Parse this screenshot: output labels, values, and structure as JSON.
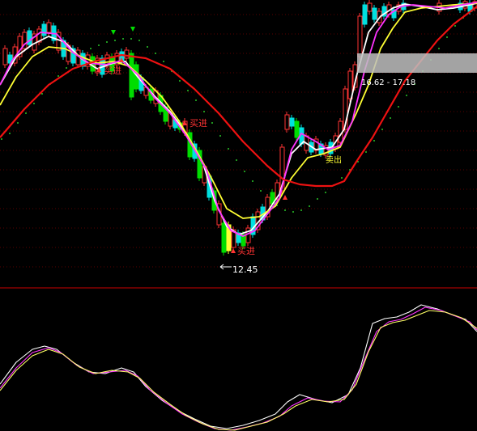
{
  "chart_data": [
    {
      "type": "candlestick",
      "panel": "main",
      "annotations": {
        "low_price_label": "12.45",
        "price_range_label": "16.62 - 17.18",
        "signals": [
          "买进",
          "买进",
          "卖出",
          "买进"
        ]
      },
      "colors": {
        "up": "#ff3333",
        "down": "#00e0e0",
        "green_bar": "#00dd00",
        "ma_white": "#ffffff",
        "ma_yellow": "#ffff33",
        "ma_magenta": "#ff33ff",
        "ma_red": "#ee1111",
        "dots": "#33ff33"
      },
      "series": [
        {
          "values": [
            [
              0,
              105
            ],
            [
              20,
              70
            ],
            [
              40,
              55
            ],
            [
              60,
              45
            ],
            [
              80,
              52
            ],
            [
              100,
              72
            ],
            [
              120,
              85
            ],
            [
              140,
              78
            ],
            [
              155,
              76
            ],
            [
              170,
              95
            ],
            [
              190,
              118
            ],
            [
              210,
              138
            ],
            [
              230,
              165
            ],
            [
              250,
              200
            ],
            [
              265,
              248
            ],
            [
              280,
              280
            ],
            [
              295,
              290
            ],
            [
              310,
              285
            ],
            [
              330,
              262
            ],
            [
              345,
              240
            ],
            [
              360,
              190
            ],
            [
              375,
              175
            ],
            [
              390,
              185
            ],
            [
              410,
              182
            ],
            [
              425,
              160
            ],
            [
              440,
              95
            ],
            [
              455,
              40
            ],
            [
              470,
              20
            ],
            [
              485,
              10
            ],
            [
              500,
              5
            ],
            [
              520,
              8
            ],
            [
              540,
              12
            ],
            [
              560,
              10
            ],
            [
              580,
              6
            ],
            [
              589,
              4
            ]
          ]
        },
        {
          "values": [
            [
              0,
              130
            ],
            [
              20,
              95
            ],
            [
              40,
              70
            ],
            [
              60,
              58
            ],
            [
              80,
              60
            ],
            [
              100,
              70
            ],
            [
              120,
              78
            ],
            [
              140,
              76
            ],
            [
              160,
              82
            ],
            [
              180,
              100
            ],
            [
              200,
              120
            ],
            [
              220,
              148
            ],
            [
              240,
              182
            ],
            [
              260,
              218
            ],
            [
              280,
              258
            ],
            [
              300,
              270
            ],
            [
              320,
              268
            ],
            [
              340,
              255
            ],
            [
              360,
              220
            ],
            [
              380,
              195
            ],
            [
              400,
              190
            ],
            [
              420,
              182
            ],
            [
              440,
              140
            ],
            [
              455,
              105
            ],
            [
              470,
              60
            ],
            [
              485,
              35
            ],
            [
              500,
              15
            ],
            [
              520,
              10
            ],
            [
              540,
              8
            ],
            [
              560,
              6
            ],
            [
              589,
              4
            ]
          ]
        },
        {
          "values": [
            [
              0,
              105
            ],
            [
              15,
              75
            ],
            [
              30,
              55
            ],
            [
              50,
              40
            ],
            [
              70,
              42
            ],
            [
              90,
              65
            ],
            [
              110,
              78
            ],
            [
              130,
              80
            ],
            [
              150,
              75
            ],
            [
              170,
              92
            ],
            [
              190,
              120
            ],
            [
              210,
              140
            ],
            [
              230,
              168
            ],
            [
              255,
              210
            ],
            [
              270,
              260
            ],
            [
              285,
              285
            ],
            [
              300,
              292
            ],
            [
              315,
              285
            ],
            [
              330,
              265
            ],
            [
              345,
              245
            ],
            [
              360,
              185
            ],
            [
              372,
              165
            ],
            [
              390,
              175
            ],
            [
              405,
              185
            ],
            [
              420,
              180
            ],
            [
              435,
              150
            ],
            [
              450,
              88
            ],
            [
              465,
              40
            ],
            [
              480,
              18
            ],
            [
              495,
              8
            ],
            [
              510,
              6
            ],
            [
              530,
              8
            ],
            [
              550,
              10
            ],
            [
              570,
              6
            ],
            [
              589,
              3
            ]
          ]
        },
        {
          "values": [
            [
              0,
              170
            ],
            [
              30,
              135
            ],
            [
              60,
              105
            ],
            [
              90,
              85
            ],
            [
              120,
              75
            ],
            [
              150,
              68
            ],
            [
              180,
              72
            ],
            [
              210,
              85
            ],
            [
              240,
              110
            ],
            [
              270,
              140
            ],
            [
              300,
              175
            ],
            [
              330,
              205
            ],
            [
              350,
              222
            ],
            [
              370,
              228
            ],
            [
              390,
              230
            ],
            [
              410,
              230
            ],
            [
              425,
              224
            ],
            [
              440,
              200
            ],
            [
              460,
              170
            ],
            [
              480,
              135
            ],
            [
              500,
              100
            ],
            [
              520,
              75
            ],
            [
              540,
              50
            ],
            [
              560,
              30
            ],
            [
              589,
              8
            ]
          ]
        },
        {
          "values": [
            [
              0,
              175
            ],
            [
              40,
              140
            ],
            [
              80,
              105
            ],
            [
              120,
              70
            ],
            [
              150,
              52
            ],
            [
              180,
              60
            ],
            [
              210,
              78
            ],
            [
              240,
              108
            ],
            [
              270,
              150
            ],
            [
              300,
              198
            ],
            [
              330,
              238
            ],
            [
              360,
              256
            ],
            [
              390,
              252
            ],
            [
              420,
              238
            ],
            [
              440,
              213
            ],
            [
              460,
              178
            ],
            [
              480,
              138
            ],
            [
              500,
              100
            ],
            [
              520,
              70
            ],
            [
              540,
              45
            ],
            [
              560,
              25
            ],
            [
              589,
              5
            ]
          ]
        }
      ]
    },
    {
      "type": "line",
      "panel": "indicator",
      "series": [
        {
          "values": [
            [
              0,
              475
            ],
            [
              20,
              448
            ],
            [
              40,
              432
            ],
            [
              55,
              428
            ],
            [
              70,
              432
            ],
            [
              90,
              448
            ],
            [
              110,
              460
            ],
            [
              130,
              462
            ],
            [
              150,
              455
            ],
            [
              165,
              460
            ],
            [
              180,
              478
            ],
            [
              200,
              495
            ],
            [
              220,
              508
            ],
            [
              240,
              518
            ],
            [
              260,
              527
            ],
            [
              280,
              530
            ],
            [
              300,
              526
            ],
            [
              320,
              520
            ],
            [
              340,
              512
            ],
            [
              355,
              497
            ],
            [
              370,
              488
            ],
            [
              390,
              494
            ],
            [
              410,
              498
            ],
            [
              430,
              488
            ],
            [
              445,
              455
            ],
            [
              460,
              400
            ],
            [
              475,
              394
            ],
            [
              490,
              392
            ],
            [
              505,
              386
            ],
            [
              520,
              377
            ],
            [
              540,
              382
            ],
            [
              560,
              390
            ],
            [
              575,
              395
            ],
            [
              589,
              410
            ]
          ]
        },
        {
          "values": [
            [
              0,
              480
            ],
            [
              20,
              455
            ],
            [
              40,
              436
            ],
            [
              60,
              430
            ],
            [
              75,
              436
            ],
            [
              95,
              452
            ],
            [
              115,
              462
            ],
            [
              135,
              460
            ],
            [
              155,
              458
            ],
            [
              170,
              465
            ],
            [
              185,
              482
            ],
            [
              205,
              498
            ],
            [
              225,
              512
            ],
            [
              245,
              522
            ],
            [
              265,
              530
            ],
            [
              285,
              532
            ],
            [
              305,
              528
            ],
            [
              325,
              523
            ],
            [
              345,
              515
            ],
            [
              360,
              502
            ],
            [
              380,
              492
            ],
            [
              400,
              496
            ],
            [
              420,
              497
            ],
            [
              435,
              482
            ],
            [
              450,
              445
            ],
            [
              465,
              410
            ],
            [
              480,
              398
            ],
            [
              495,
              395
            ],
            [
              510,
              388
            ],
            [
              525,
              380
            ],
            [
              545,
              384
            ],
            [
              565,
              392
            ],
            [
              580,
              398
            ],
            [
              589,
              408
            ]
          ]
        },
        {
          "values": [
            [
              0,
              483
            ],
            [
              20,
              458
            ],
            [
              40,
              440
            ],
            [
              60,
              432
            ],
            [
              78,
              438
            ],
            [
              98,
              454
            ],
            [
              118,
              462
            ],
            [
              138,
              458
            ],
            [
              158,
              460
            ],
            [
              173,
              468
            ],
            [
              190,
              485
            ],
            [
              210,
              500
            ],
            [
              230,
              514
            ],
            [
              250,
              524
            ],
            [
              270,
              531
            ],
            [
              290,
              532
            ],
            [
              310,
              527
            ],
            [
              330,
              522
            ],
            [
              350,
              512
            ],
            [
              365,
              502
            ],
            [
              385,
              494
            ],
            [
              405,
              497
            ],
            [
              425,
              494
            ],
            [
              440,
              475
            ],
            [
              455,
              435
            ],
            [
              470,
              405
            ],
            [
              485,
              399
            ],
            [
              500,
              396
            ],
            [
              515,
              390
            ],
            [
              530,
              384
            ],
            [
              550,
              386
            ],
            [
              570,
              393
            ],
            [
              589,
              406
            ]
          ]
        }
      ]
    }
  ]
}
